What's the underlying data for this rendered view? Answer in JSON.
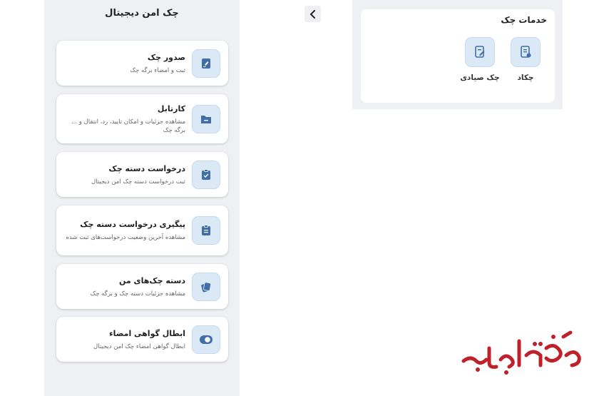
{
  "left_screen": {
    "title": "چک امن دیجیتال",
    "items": [
      {
        "title": "صدور چک",
        "desc": "ثبت و امضاء برگه چک",
        "icon": "check-issue-icon"
      },
      {
        "title": "کارتابل",
        "desc": "مشاهده جزئیات و امکان تایید، رد، انتقال و ... برگه چک",
        "icon": "folder-icon"
      },
      {
        "title": "درخواست دسته چک",
        "desc": "ثبت درخواست دسته چک امن دیجیتال",
        "icon": "clipboard-check-icon"
      },
      {
        "title": "پیگیری درخواست دسته چک",
        "desc": "مشاهده آخرین وضعیت درخواست‌های ثبت شده",
        "icon": "clipboard-list-icon"
      },
      {
        "title": "دسته چک‌های من",
        "desc": "مشاهده جزئیات دسته چک و برگه چک",
        "icon": "cheque-books-icon"
      },
      {
        "title": "ابطال گواهی امضاء",
        "desc": "ابطال گواهی امضاء چک امن دیجیتال",
        "icon": "toggle-icon"
      }
    ]
  },
  "right_screen": {
    "services_title": "خدمات چک",
    "services": [
      {
        "label": "چکاد",
        "icon": "chakad-icon"
      },
      {
        "label": "چک صیادی",
        "icon": "sayadi-check-icon"
      }
    ]
  },
  "watermark": {
    "text": "صفحه اقتصاد",
    "color": "#c0202a"
  },
  "colors": {
    "accent": "#3f6fa6",
    "icon_bg": "#dbe9f7",
    "screen_bg": "#eff0f3"
  }
}
